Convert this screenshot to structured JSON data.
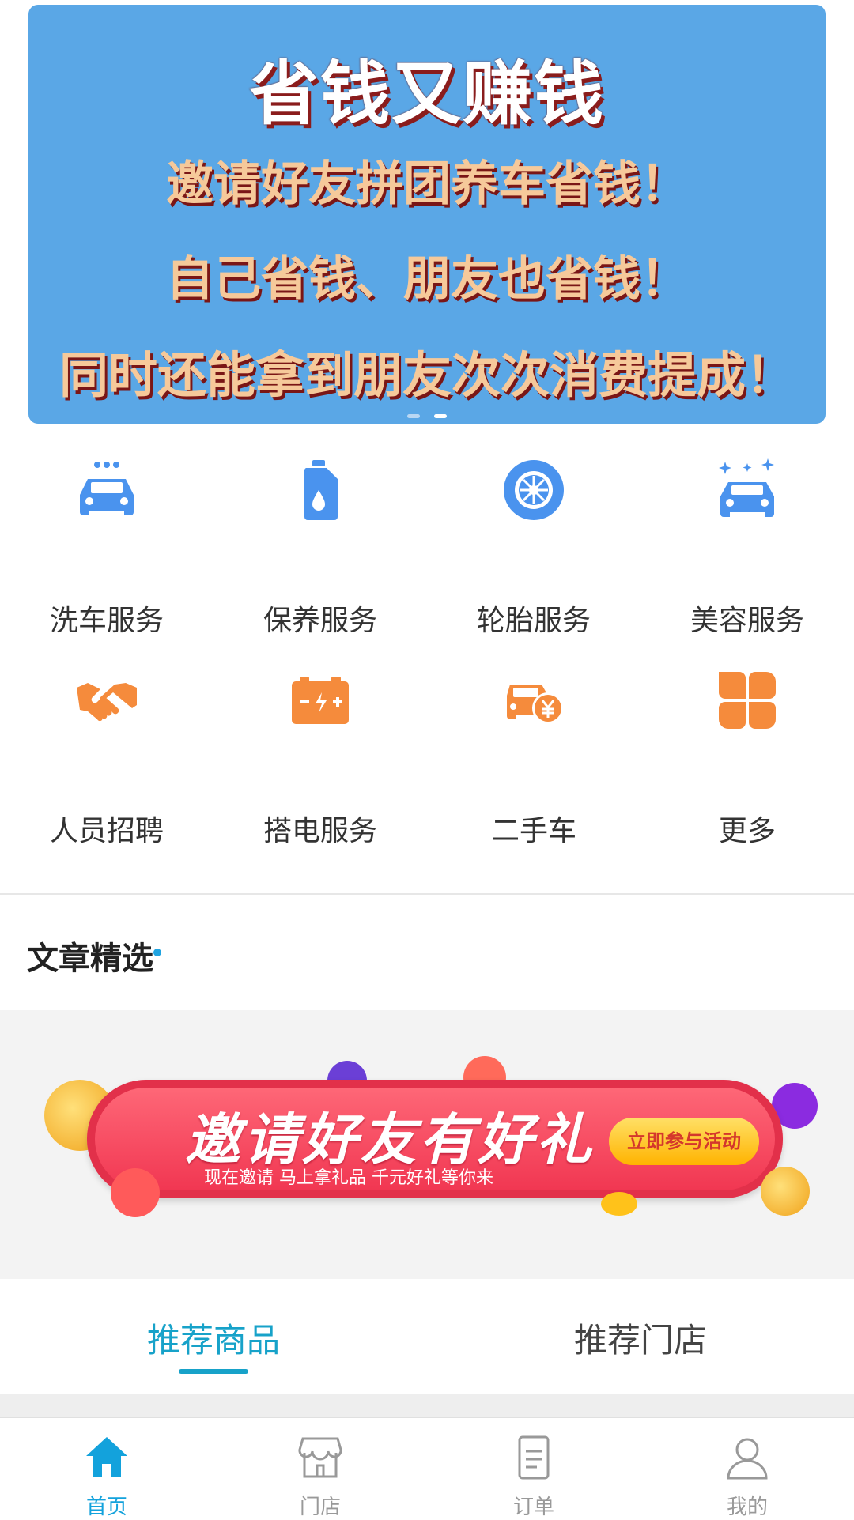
{
  "banner": {
    "title": "省钱又赚钱",
    "line1": "邀请好友拼团养车省钱！",
    "line2": "自己省钱、朋友也省钱！",
    "line3": "同时还能拿到朋友次次消费提成！",
    "slide_count": 2,
    "active_slide": 2
  },
  "services": [
    {
      "label": "洗车服务",
      "icon": "car-wash-icon"
    },
    {
      "label": "保养服务",
      "icon": "oil-can-icon"
    },
    {
      "label": "轮胎服务",
      "icon": "tire-icon"
    },
    {
      "label": "美容服务",
      "icon": "car-sparkle-icon"
    },
    {
      "label": "人员招聘",
      "icon": "handshake-icon"
    },
    {
      "label": "搭电服务",
      "icon": "battery-icon"
    },
    {
      "label": "二手车",
      "icon": "car-yuan-icon"
    },
    {
      "label": "更多",
      "icon": "more-grid-icon"
    }
  ],
  "articles": {
    "title": "文章精选",
    "promo": {
      "headline": "邀请好友有好礼",
      "subline": "现在邀请 马上拿礼品    千元好礼等你来",
      "cta": "立即参与活动"
    }
  },
  "tabs": [
    {
      "label": "推荐商品",
      "active": true
    },
    {
      "label": "推荐门店",
      "active": false
    }
  ],
  "nav": [
    {
      "label": "首页",
      "icon": "home-icon",
      "active": true
    },
    {
      "label": "门店",
      "icon": "store-icon",
      "active": false
    },
    {
      "label": "订单",
      "icon": "order-icon",
      "active": false
    },
    {
      "label": "我的",
      "icon": "user-icon",
      "active": false
    }
  ],
  "colors": {
    "banner_bg": "#5aa7e6",
    "service_blue": "#4a93ee",
    "service_orange": "#f58b3c",
    "accent": "#17a2c9"
  }
}
